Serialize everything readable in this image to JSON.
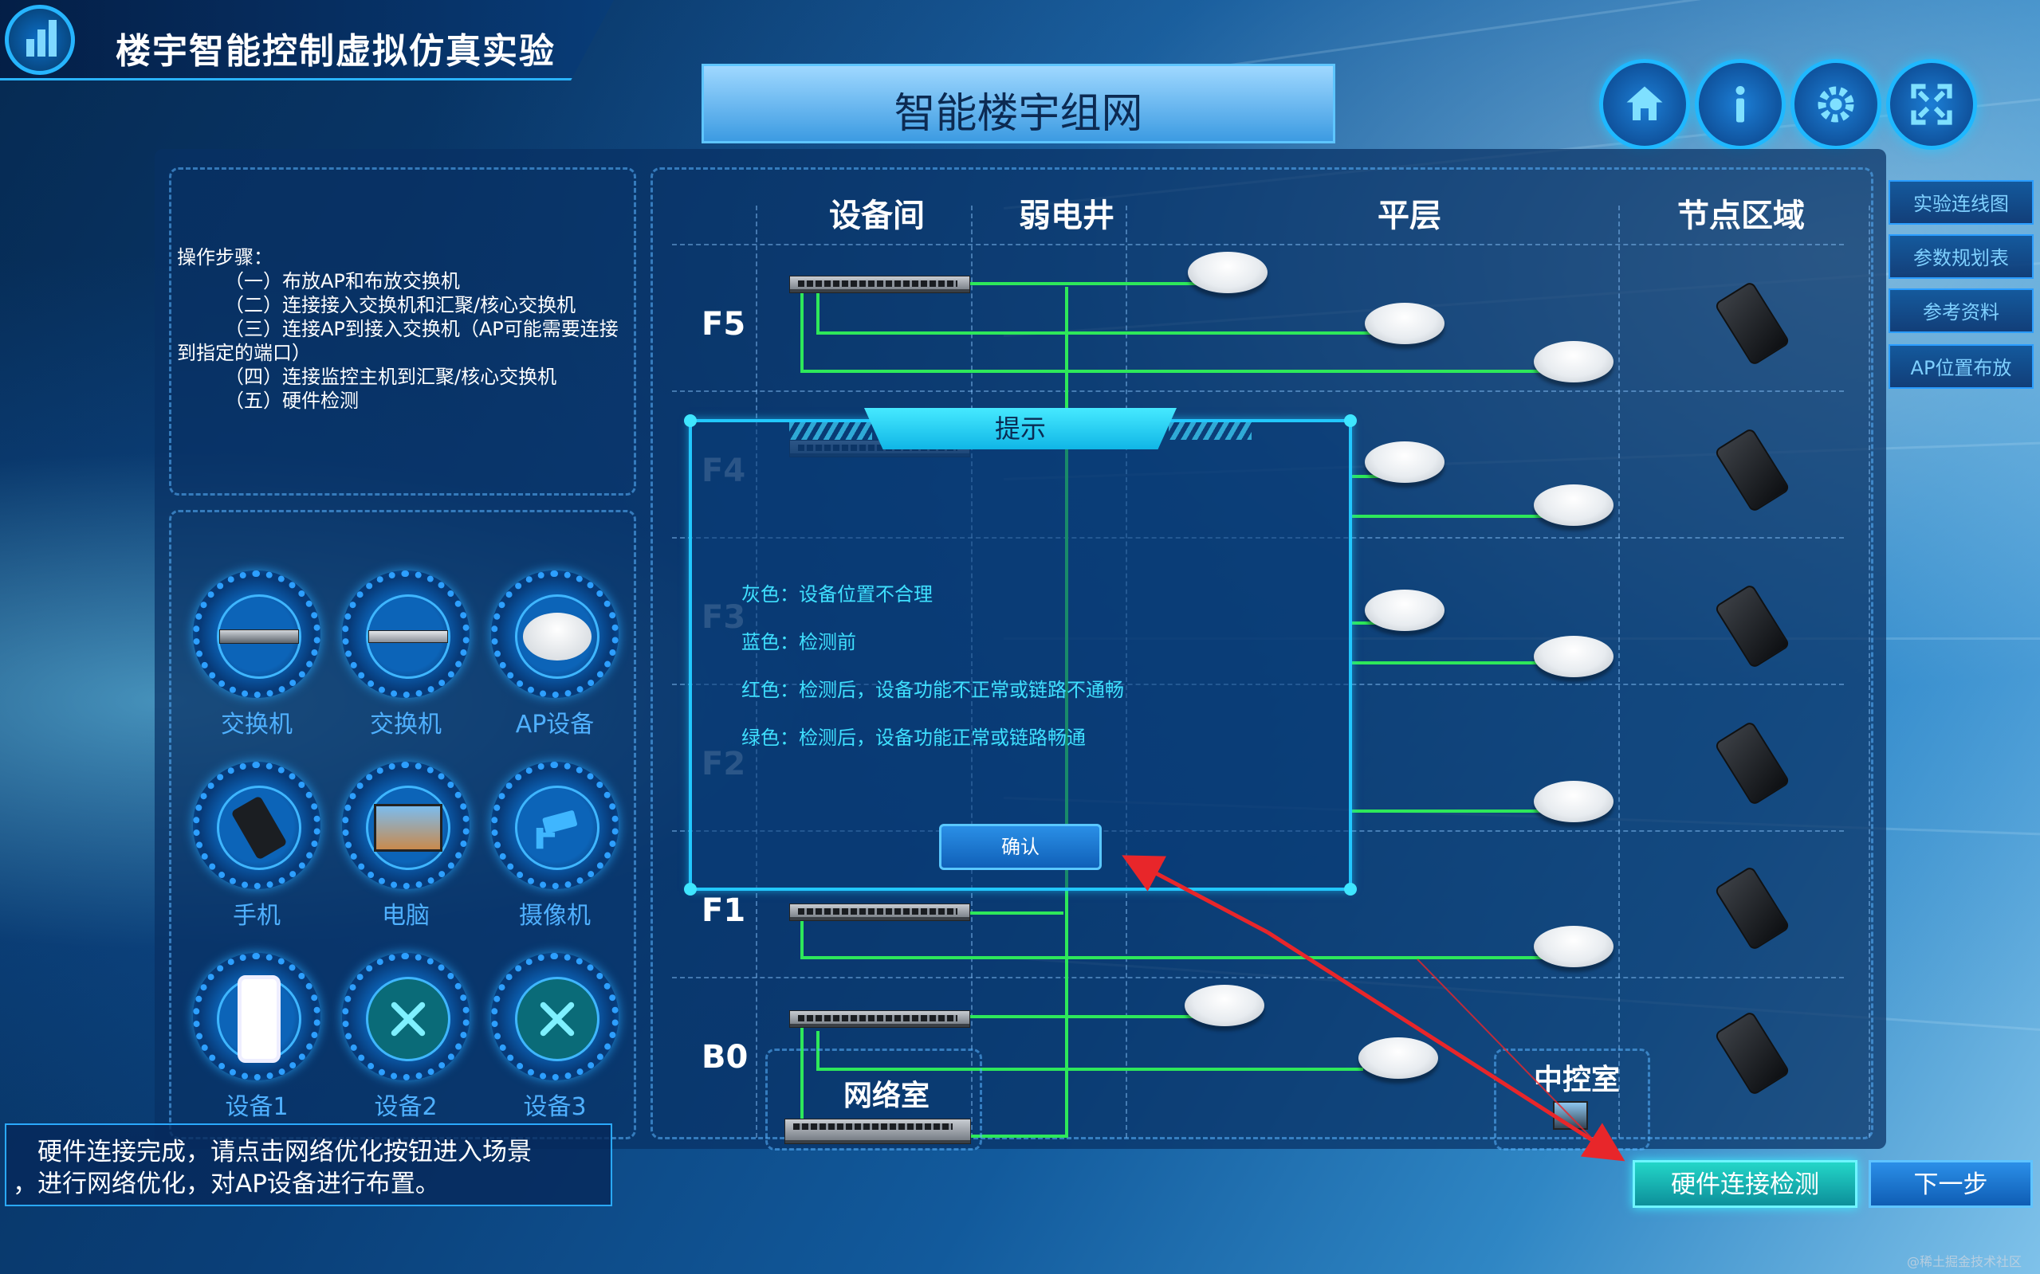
{
  "app": {
    "title": "楼宇智能控制虚拟仿真实验"
  },
  "scene": {
    "title": "智能楼宇组网"
  },
  "top_buttons": [
    "home-icon",
    "info-icon",
    "gear-icon",
    "fullscreen-icon"
  ],
  "steps": {
    "heading": "操作步骤：",
    "items": [
      "（一）布放AP和布放交换机",
      "（二）连接接入交换机和汇聚/核心交换机",
      "（三）连接AP到接入交换机（AP可能需要连接",
      "到指定的端口）",
      "（四）连接监控主机到汇聚/核心交换机",
      "（五）硬件检测"
    ]
  },
  "devices": [
    {
      "label": "交换机",
      "icon": "switch-icon"
    },
    {
      "label": "交换机",
      "icon": "switch-icon"
    },
    {
      "label": "AP设备",
      "icon": "access-point-icon"
    },
    {
      "label": "手机",
      "icon": "phone-icon"
    },
    {
      "label": "电脑",
      "icon": "computer-icon"
    },
    {
      "label": "摄像机",
      "icon": "camera-icon"
    },
    {
      "label": "设备1",
      "icon": "smartphone-icon"
    },
    {
      "label": "设备2",
      "icon": "tools-icon"
    },
    {
      "label": "设备3",
      "icon": "tools-icon"
    }
  ],
  "side_menu": [
    "实验连线图",
    "参数规划表",
    "参考资料",
    "AP位置布放"
  ],
  "topology": {
    "columns": [
      "设备间",
      "弱电井",
      "平层",
      "节点区域"
    ],
    "floors": [
      "F5",
      "F4",
      "F3",
      "F2",
      "F1",
      "B0"
    ],
    "rooms": {
      "network_room": "网络室",
      "control_room": "中控室"
    }
  },
  "dialog": {
    "title": "提示",
    "lines": [
      "灰色：设备位置不合理",
      "蓝色：检测前",
      "红色：检测后，设备功能不正常或链路不通畅",
      "绿色：检测后，设备功能正常或链路畅通"
    ],
    "confirm_label": "确认"
  },
  "bottom_message": {
    "line1": "　硬件连接完成，请点击网络优化按钮进入场景",
    "line2": "，进行网络优化，对AP设备进行布置。"
  },
  "actions": {
    "check_label": "硬件连接检测",
    "next_label": "下一步"
  },
  "watermark": "@稀土掘金技术社区",
  "colors": {
    "link_green": "#2ee85a",
    "accent_cyan": "#22c8ff",
    "annotation_red": "#e8262a"
  }
}
